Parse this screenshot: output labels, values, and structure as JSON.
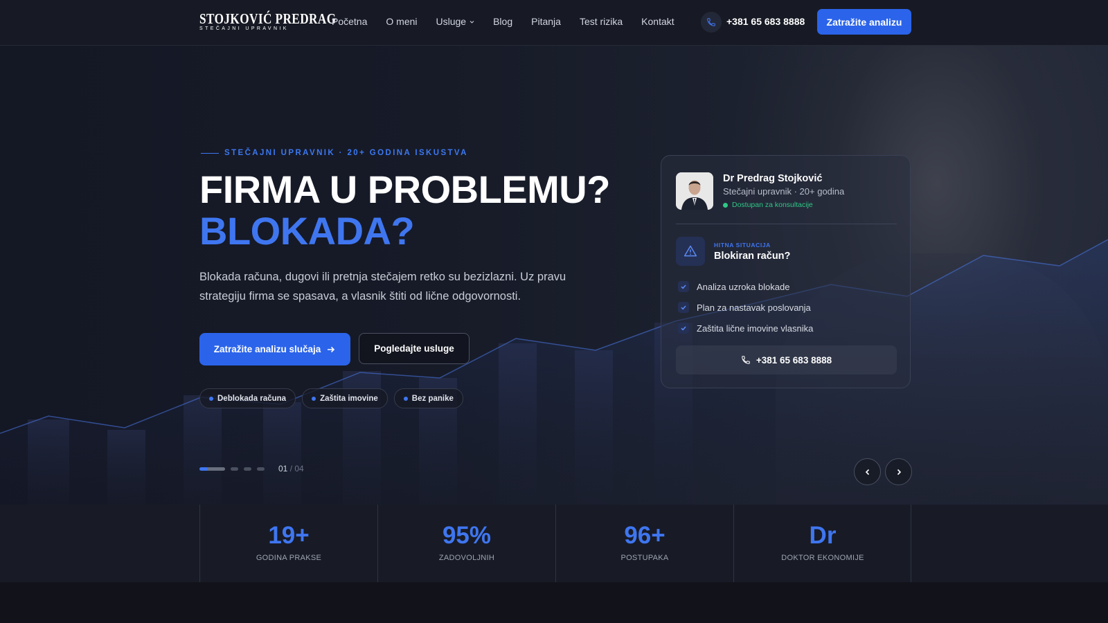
{
  "nav": {
    "logo_main": "STOJKOVIĆ PREDRAG",
    "logo_sub": "STEČAJNI UPRAVNIK",
    "items": [
      {
        "label": "Početna"
      },
      {
        "label": "O meni"
      },
      {
        "label": "Usluge"
      },
      {
        "label": "Blog"
      },
      {
        "label": "Pitanja"
      },
      {
        "label": "Test rizika"
      },
      {
        "label": "Kontakt"
      }
    ],
    "phone": "+381 65 683 8888",
    "cta": "Zatražite analizu"
  },
  "hero": {
    "eyebrow": "STEČAJNI UPRAVNIK · 20+ GODINA ISKUSTVA",
    "title_line1": "FIRMA U PROBLEMU?",
    "title_line2": "BLOKADA?",
    "lead": "Blokada računa, dugovi ili pretnja stečajem retko su bezizlazni. Uz pravu strategiju firma se spasava, a vlasnik štiti od lične odgovornosti.",
    "primary_button": "Zatražite analizu slučaja",
    "secondary_button": "Pogledajte usluge",
    "chips": [
      {
        "label": "Deblokada računa"
      },
      {
        "label": "Zaštita imovine"
      },
      {
        "label": "Bez panike"
      }
    ],
    "slider": {
      "current": "01",
      "total": "04",
      "active_index": 0
    }
  },
  "card": {
    "name": "Dr Predrag Stojković",
    "role": "Stečajni upravnik · 20+ godina",
    "status": "Dostupan za konsultacije",
    "urgent_label": "HITNA SITUACIJA",
    "urgent_title": "Blokiran račun?",
    "checks": [
      {
        "label": "Analiza uzroka blokade"
      },
      {
        "label": "Plan za nastavak poslovanja"
      },
      {
        "label": "Zaštita lične imovine vlasnika"
      }
    ],
    "phone": "+381 65 683 8888"
  },
  "stats": [
    {
      "value": "19+",
      "label": "GODINA PRAKSE"
    },
    {
      "value": "95%",
      "label": "ZADOVOLJNIH"
    },
    {
      "value": "96+",
      "label": "POSTUPAKA"
    },
    {
      "value": "Dr",
      "label": "DOKTOR EKONOMIJE"
    }
  ],
  "colors": {
    "accent": "#3f76f0",
    "button": "#2b64ea",
    "status_green": "#2fc886",
    "background": "#12141d"
  },
  "icons": [
    "phone-icon",
    "chevron-down-icon",
    "arrow-right-icon",
    "warning-icon",
    "check-icon",
    "chevron-left-icon",
    "chevron-right-icon"
  ]
}
